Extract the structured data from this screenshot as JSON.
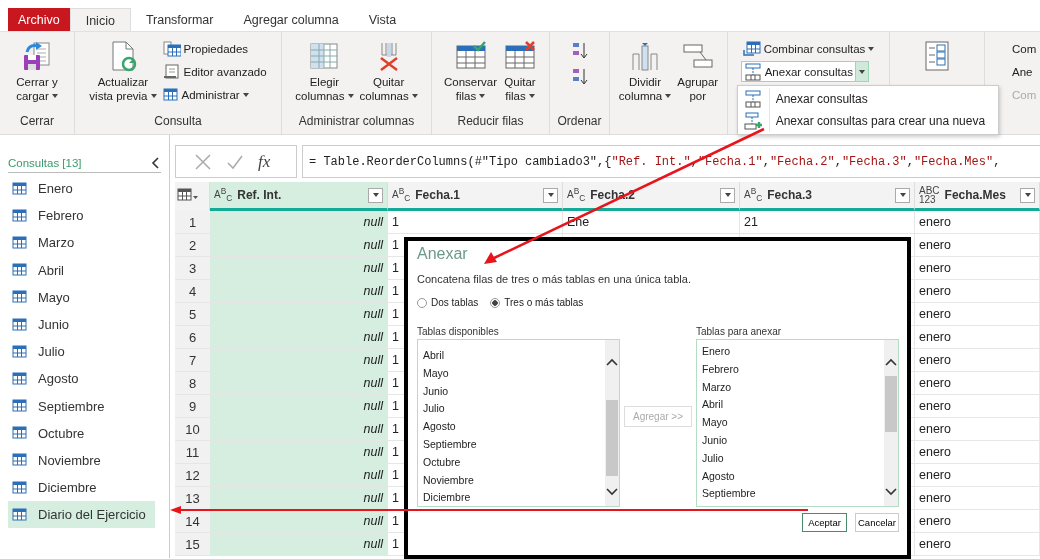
{
  "tabs": [
    {
      "label": "Archivo",
      "kind": "file",
      "selected": false
    },
    {
      "label": "Inicio",
      "kind": "tab",
      "selected": true
    },
    {
      "label": "Transformar",
      "kind": "tab",
      "selected": false
    },
    {
      "label": "Agregar columna",
      "kind": "tab",
      "selected": false
    },
    {
      "label": "Vista",
      "kind": "tab",
      "selected": false
    }
  ],
  "ribbon": {
    "groups": [
      {
        "label": "Cerrar",
        "items": [
          {
            "kind": "large",
            "lines": [
              "Cerrar y",
              "cargar"
            ],
            "dropdown": true
          }
        ]
      },
      {
        "label": "Consulta",
        "items": [
          {
            "kind": "large",
            "lines": [
              "Actualizar",
              "vista previa"
            ],
            "dropdown": true
          },
          {
            "kind": "small",
            "label": "Propiedades",
            "dropdown": false
          },
          {
            "kind": "small",
            "label": "Editor avanzado",
            "dropdown": false
          },
          {
            "kind": "small",
            "label": "Administrar",
            "dropdown": true
          }
        ]
      },
      {
        "label": "Administrar columnas",
        "items": [
          {
            "kind": "large",
            "lines": [
              "Elegir",
              "columnas"
            ],
            "dropdown": true
          },
          {
            "kind": "large",
            "lines": [
              "Quitar",
              "columnas"
            ],
            "dropdown": true
          }
        ]
      },
      {
        "label": "Reducir filas",
        "items": [
          {
            "kind": "large",
            "lines": [
              "Conservar",
              "filas"
            ],
            "dropdown": true
          },
          {
            "kind": "large",
            "lines": [
              "Quitar",
              "filas"
            ],
            "dropdown": true
          }
        ]
      },
      {
        "label": "Ordenar",
        "items": [
          {
            "kind": "icon"
          },
          {
            "kind": "icon"
          }
        ]
      },
      {
        "items": [
          {
            "kind": "large",
            "lines": [
              "Dividir",
              "columna"
            ],
            "dropdown": true
          },
          {
            "kind": "large",
            "lines": [
              "Agrupar",
              "por"
            ],
            "dropdown": false
          }
        ]
      },
      {
        "items": [
          {
            "kind": "small",
            "label": "Combinar consultas",
            "dropdown": true
          },
          {
            "kind": "split",
            "label": "Anexar consultas",
            "dropdown": true,
            "open": true,
            "menu": [
              {
                "label": "Anexar consultas"
              },
              {
                "label": "Anexar consultas para crear una nueva"
              }
            ]
          }
        ]
      },
      {
        "items": [
          {
            "kind": "large"
          }
        ]
      },
      {
        "items": [
          {
            "kind": "small",
            "label": "Com",
            "dropdown": false,
            "disabled": false
          },
          {
            "kind": "small",
            "label": "Ane",
            "dropdown": false,
            "disabled": false
          },
          {
            "kind": "small",
            "label": "Com",
            "dropdown": false,
            "disabled": true
          }
        ]
      }
    ]
  },
  "queries": {
    "title": "Consultas [13]",
    "items": [
      {
        "label": "Enero",
        "selected": false
      },
      {
        "label": "Febrero",
        "selected": false
      },
      {
        "label": "Marzo",
        "selected": false
      },
      {
        "label": "Abril",
        "selected": false
      },
      {
        "label": "Mayo",
        "selected": false
      },
      {
        "label": "Junio",
        "selected": false
      },
      {
        "label": "Julio",
        "selected": false
      },
      {
        "label": "Agosto",
        "selected": false
      },
      {
        "label": "Septiembre",
        "selected": false
      },
      {
        "label": "Octubre",
        "selected": false
      },
      {
        "label": "Noviembre",
        "selected": false
      },
      {
        "label": "Diciembre",
        "selected": false
      },
      {
        "label": "Diario del Ejercicio",
        "selected": true
      }
    ]
  },
  "formula_bar": {
    "fx": "fx",
    "segments": [
      {
        "kind": "code",
        "text": "= Table.ReorderColumns(#\"Tipo cambiado3\",{"
      },
      {
        "kind": "string",
        "text": "\"Ref. Int.\""
      },
      {
        "kind": "code",
        "text": ", "
      },
      {
        "kind": "string",
        "text": "\"Fecha.1\""
      },
      {
        "kind": "code",
        "text": ", "
      },
      {
        "kind": "string",
        "text": "\"Fecha.2\""
      },
      {
        "kind": "code",
        "text": ", "
      },
      {
        "kind": "string",
        "text": "\"Fecha.3\""
      },
      {
        "kind": "code",
        "text": ", "
      },
      {
        "kind": "string",
        "text": "\"Fecha.Mes\""
      },
      {
        "kind": "code",
        "text": ","
      }
    ]
  },
  "table": {
    "columns": [
      {
        "name": "Ref. Int.",
        "type": "A$^{B}$$_{C}$",
        "selected": true
      },
      {
        "name": "Fecha.1",
        "type": "A$^{B}$$_{C}$",
        "selected": false
      },
      {
        "name": "Fecha.2",
        "type": "A$^{B}$$_{C}$",
        "selected": false
      },
      {
        "name": "Fecha.3",
        "type": "A$^{B}$$_{C}$",
        "selected": false
      },
      {
        "name": "Fecha.Mes",
        "type": "ABC\n123",
        "selected": false
      }
    ],
    "rows": [
      {
        "n": "1",
        "cells": [
          "null",
          "1",
          "Ene",
          "21",
          "enero"
        ]
      },
      {
        "n": "2",
        "cells": [
          "null",
          "1",
          "",
          "",
          "enero"
        ]
      },
      {
        "n": "3",
        "cells": [
          "null",
          "1",
          "",
          "",
          "enero"
        ]
      },
      {
        "n": "4",
        "cells": [
          "null",
          "1",
          "",
          "",
          "enero"
        ]
      },
      {
        "n": "5",
        "cells": [
          "null",
          "1",
          "",
          "",
          "enero"
        ]
      },
      {
        "n": "6",
        "cells": [
          "null",
          "1",
          "",
          "",
          "enero"
        ]
      },
      {
        "n": "7",
        "cells": [
          "null",
          "1",
          "",
          "",
          "enero"
        ]
      },
      {
        "n": "8",
        "cells": [
          "null",
          "1",
          "",
          "",
          "enero"
        ]
      },
      {
        "n": "9",
        "cells": [
          "null",
          "1",
          "",
          "",
          "enero"
        ]
      },
      {
        "n": "10",
        "cells": [
          "null",
          "1",
          "",
          "",
          "enero"
        ]
      },
      {
        "n": "11",
        "cells": [
          "null",
          "1",
          "",
          "",
          "enero"
        ]
      },
      {
        "n": "12",
        "cells": [
          "null",
          "1",
          "",
          "",
          "enero"
        ]
      },
      {
        "n": "13",
        "cells": [
          "null",
          "1",
          "",
          "",
          "enero"
        ]
      },
      {
        "n": "14",
        "cells": [
          "null",
          "1",
          "",
          "",
          "enero"
        ]
      },
      {
        "n": "15",
        "cells": [
          "null",
          "1",
          "",
          "",
          "enero"
        ]
      }
    ]
  },
  "dialog": {
    "title": "Anexar",
    "description": "Concatena filas de tres o más tablas en una única tabla.",
    "options": [
      {
        "label": "Dos tablas",
        "selected": false
      },
      {
        "label": "Tres o más tablas",
        "selected": true
      }
    ],
    "available": {
      "label": "Tablas disponibles",
      "items": [
        "Abril",
        "Mayo",
        "Junio",
        "Julio",
        "Agosto",
        "Septiembre",
        "Octubre",
        "Noviembre",
        "Diciembre"
      ]
    },
    "add_button": {
      "label": "Agregar >>",
      "disabled": true
    },
    "to_append": {
      "label": "Tablas para anexar",
      "items": [
        "Enero",
        "Febrero",
        "Marzo",
        "Abril",
        "Mayo",
        "Junio",
        "Julio",
        "Agosto",
        "Septiembre"
      ]
    },
    "buttons": [
      {
        "label": "Aceptar",
        "kind": "primary"
      },
      {
        "label": "Cancelar",
        "kind": "secondary"
      }
    ]
  }
}
